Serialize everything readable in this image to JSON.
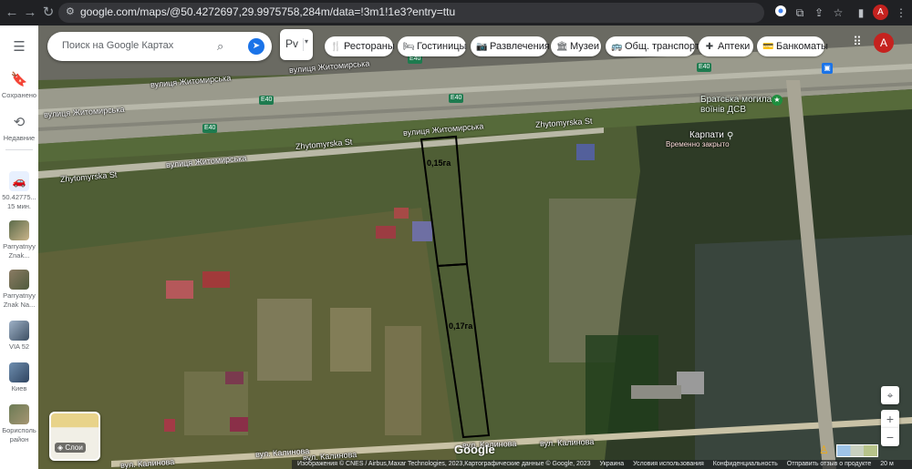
{
  "browser": {
    "url": "google.com/maps/@50.4272697,29.9975758,284m/data=!3m1!1e3?entry=ttu",
    "profile_initial": "A",
    "profile_color": "#c5221f"
  },
  "rail": {
    "saved_label": "Сохранено",
    "recent_label": "Недавние",
    "items": [
      {
        "label": "50.42775...",
        "sublabel": "15 мин."
      },
      {
        "label": "Parryatnyy",
        "sublabel": "Znak..."
      },
      {
        "label": "Parryatnyy",
        "sublabel": "Znak Na..."
      },
      {
        "label": "VIA 52",
        "sublabel": ""
      },
      {
        "label": "Киев",
        "sublabel": ""
      },
      {
        "label": "Борисполь",
        "sublabel": "район"
      }
    ]
  },
  "search": {
    "placeholder": "Поиск на Google Картах"
  },
  "lang": {
    "label": "Рv"
  },
  "chips": [
    {
      "label": "Рестораны",
      "icon": "fork-knife-icon",
      "glyph": "🍴"
    },
    {
      "label": "Гостиницы",
      "icon": "bed-icon",
      "glyph": "🛏"
    },
    {
      "label": "Развлечения",
      "icon": "camera-icon",
      "glyph": "📷"
    },
    {
      "label": "Музеи",
      "icon": "museum-icon",
      "glyph": "🏛"
    },
    {
      "label": "Общ. транспорт",
      "icon": "transit-icon",
      "glyph": "🚌"
    },
    {
      "label": "Аптеки",
      "icon": "pharmacy-icon",
      "glyph": "✚"
    },
    {
      "label": "Банкоматы",
      "icon": "atm-icon",
      "glyph": "💳"
    }
  ],
  "map": {
    "streets": {
      "zhytomyrska_1": "вулиця Житомирська",
      "zhytomyrska_2": "вулиця Житомирська",
      "zhytomyrska_3": "вулиця Житомирська",
      "zhytomyrska_4": "вулиця Житомирська",
      "zhytomyrska_5": "вулиця Житомирська",
      "zhytomyrska_en_1": "Zhytomyrska St",
      "zhytomyrska_en_2": "Zhytomyrska St",
      "zhytomyrska_en_3": "Zhytomyrska St",
      "kalynova_1": "вул. Калинова",
      "kalynova_2": "вул. Калинова",
      "kalynova_3": "вул. Калинова",
      "kalynova_4": "вул. Калинова",
      "kalynova_5": "вул. Калинова"
    },
    "highway_badge": "E40",
    "poi": [
      {
        "title": "Братська могила",
        "subtitle": "воїнів ДСВ"
      },
      {
        "title": "Карпати",
        "subtitle": "Временно закрыто"
      }
    ],
    "plots": [
      {
        "label": "0,15га",
        "area_ha": 0.15
      },
      {
        "label": "0,17га",
        "area_ha": 0.17
      }
    ],
    "google_logo": "Google",
    "layers_label": "Слои",
    "scale": "20 м"
  },
  "footer": {
    "attribution": "Изображения © CNES / Airbus,Maxar Technologies, 2023,Картографические данные © Google, 2023",
    "country": "Украина",
    "terms": "Условия использования",
    "privacy": "Конфиденциальность",
    "feedback": "Отправить отзыв о продукте"
  }
}
